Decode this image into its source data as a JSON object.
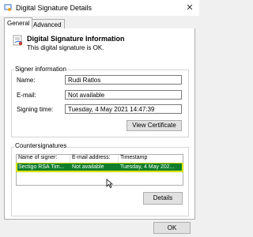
{
  "window": {
    "title": "Digital Signature Details",
    "close_glyph": "✕"
  },
  "tabs": [
    {
      "label": "General",
      "active": true
    },
    {
      "label": "Advanced",
      "active": false
    }
  ],
  "info": {
    "title": "Digital Signature Information",
    "subtitle": "This digital signature is OK."
  },
  "signer": {
    "group_label": "Signer information",
    "name_label": "Name:",
    "name_value": "Rudi Ratlos",
    "email_label": "E-mail:",
    "email_value": "Not available",
    "time_label": "Signing time:",
    "time_value": "Tuesday, 4 May 2021 14:47:39",
    "view_certificate": "View Certificate"
  },
  "countersignatures": {
    "group_label": "Countersignatures",
    "columns": [
      "Name of signer:",
      "E-mail address:",
      "Timestamp"
    ],
    "rows": [
      {
        "name": "Sectigo RSA Tim...",
        "email": "Not available",
        "timestamp": "Tuesday, 4 May 202..."
      }
    ],
    "details_button": "Details"
  },
  "footer": {
    "ok": "OK"
  },
  "colors": {
    "highlight": "#f4f400",
    "selected_row": "#0f7d2b",
    "icon_blue": "#2b6ad6",
    "icon_red": "#c0392b"
  }
}
